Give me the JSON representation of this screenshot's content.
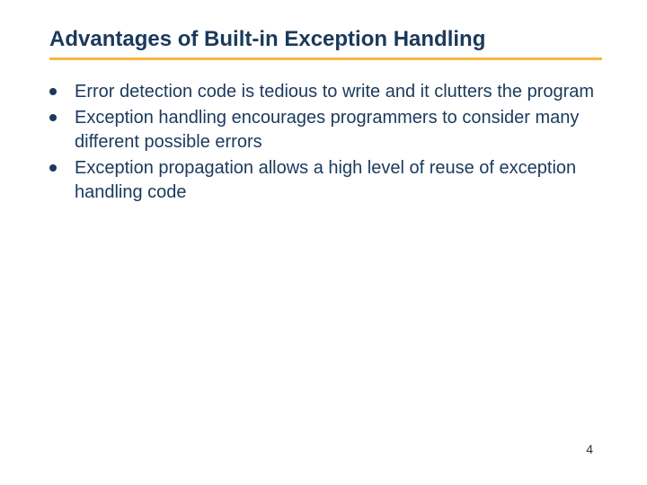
{
  "slide": {
    "title": "Advantages of Built-in Exception Handling",
    "bullets": [
      "Error detection code is tedious to write and it clutters the program",
      "Exception handling encourages programmers to consider many different possible errors",
      "Exception propagation allows a high level of reuse of exception handling code"
    ],
    "page_number": "4"
  },
  "colors": {
    "title_color": "#1a3a5c",
    "divider_color": "#f4b942",
    "text_color": "#1a3a5c"
  }
}
